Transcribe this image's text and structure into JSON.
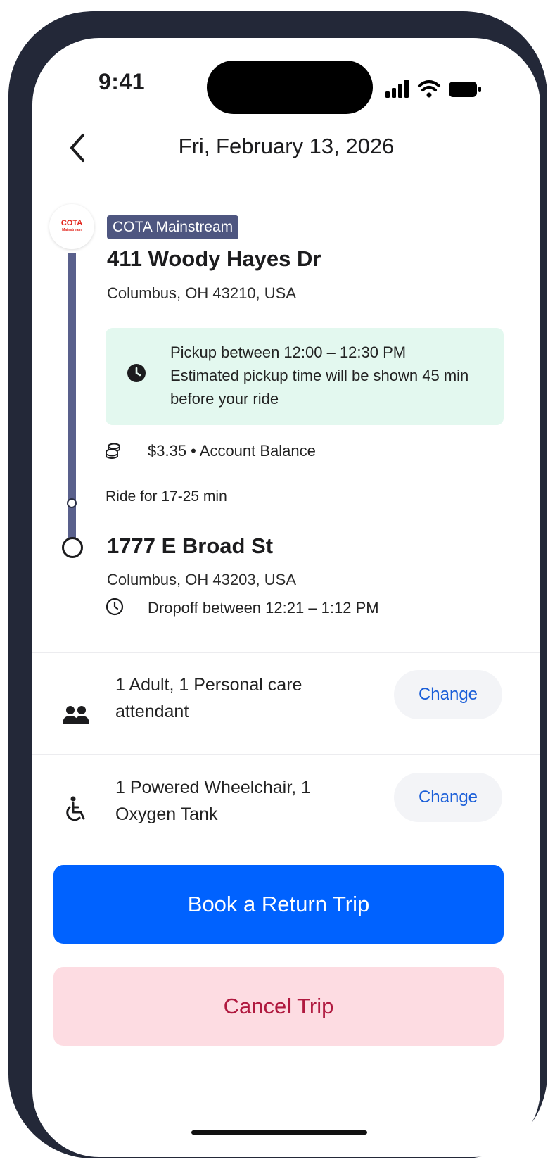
{
  "status_bar": {
    "time": "9:41"
  },
  "header": {
    "title": "Fri, February 13, 2026"
  },
  "provider": {
    "logo_text": "COTA",
    "logo_subtext": "Mainstream",
    "name": "COTA Mainstream"
  },
  "pickup": {
    "address": "411 Woody Hayes Dr",
    "city": "Columbus, OH 43210, USA",
    "window_line1": "Pickup between 12:00 – 12:30 PM",
    "window_line2": "Estimated pickup time will be shown 45 min before your ride"
  },
  "fare": {
    "text": "$3.35 • Account Balance"
  },
  "ride_duration": "Ride for 17-25 min",
  "dropoff": {
    "address": "1777 E Broad St",
    "city": "Columbus, OH 43203, USA",
    "window": "Dropoff between 12:21 – 1:12 PM"
  },
  "passengers": {
    "text": "1 Adult, 1 Personal care attendant",
    "change_label": "Change",
    "icon": "people-icon"
  },
  "equipment": {
    "text": "1 Powered Wheelchair, 1 Oxygen Tank",
    "change_label": "Change",
    "icon": "wheelchair-icon"
  },
  "actions": {
    "return_label": "Book a Return Trip",
    "cancel_label": "Cancel Trip"
  },
  "colors": {
    "primary": "#0062ff",
    "cancel_bg": "#fddce2",
    "cancel_text": "#b0193f",
    "route": "#59608c",
    "pickup_bg": "#e3f8ef",
    "provider_tag": "#4e5680",
    "link": "#1a5ed8"
  }
}
